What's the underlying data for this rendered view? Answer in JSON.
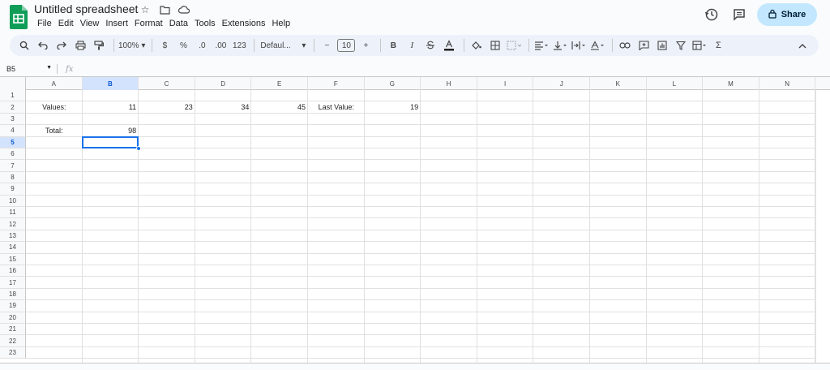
{
  "app": {
    "title": "Untitled spreadsheet",
    "menu": [
      "File",
      "Edit",
      "View",
      "Insert",
      "Format",
      "Data",
      "Tools",
      "Extensions",
      "Help"
    ],
    "share_label": "Share"
  },
  "toolbar": {
    "zoom": "100%",
    "currency": "$",
    "percent": "%",
    "decrease_decimal": ".0",
    "increase_decimal": ".00",
    "more_formats": "123",
    "font": "Defaul...",
    "font_size": "10",
    "bold": "B",
    "italic": "I",
    "sigma": "Σ"
  },
  "formula_bar": {
    "cell_ref": "B5",
    "fx": "fx",
    "content": ""
  },
  "sheet": {
    "columns": [
      "A",
      "B",
      "C",
      "D",
      "E",
      "F",
      "G",
      "H",
      "I",
      "J",
      "K",
      "L",
      "M",
      "N"
    ],
    "rows": [
      "1",
      "2",
      "3",
      "4",
      "5",
      "6",
      "7",
      "8",
      "9",
      "10",
      "11",
      "12",
      "13",
      "14",
      "15",
      "16",
      "17",
      "18",
      "19",
      "20",
      "21",
      "22",
      "23"
    ],
    "selected_column": "B",
    "selected_row": "5",
    "cells": {
      "A2": "Values:",
      "B2": "11",
      "C2": "23",
      "D2": "34",
      "E2": "45",
      "F2": "Last Value:",
      "G2": "19",
      "A4": "Total:",
      "B4": "98"
    }
  },
  "colors": {
    "accent": "#1a73e8",
    "share_bg": "#c2e7ff",
    "logo": "#0f9d58"
  }
}
